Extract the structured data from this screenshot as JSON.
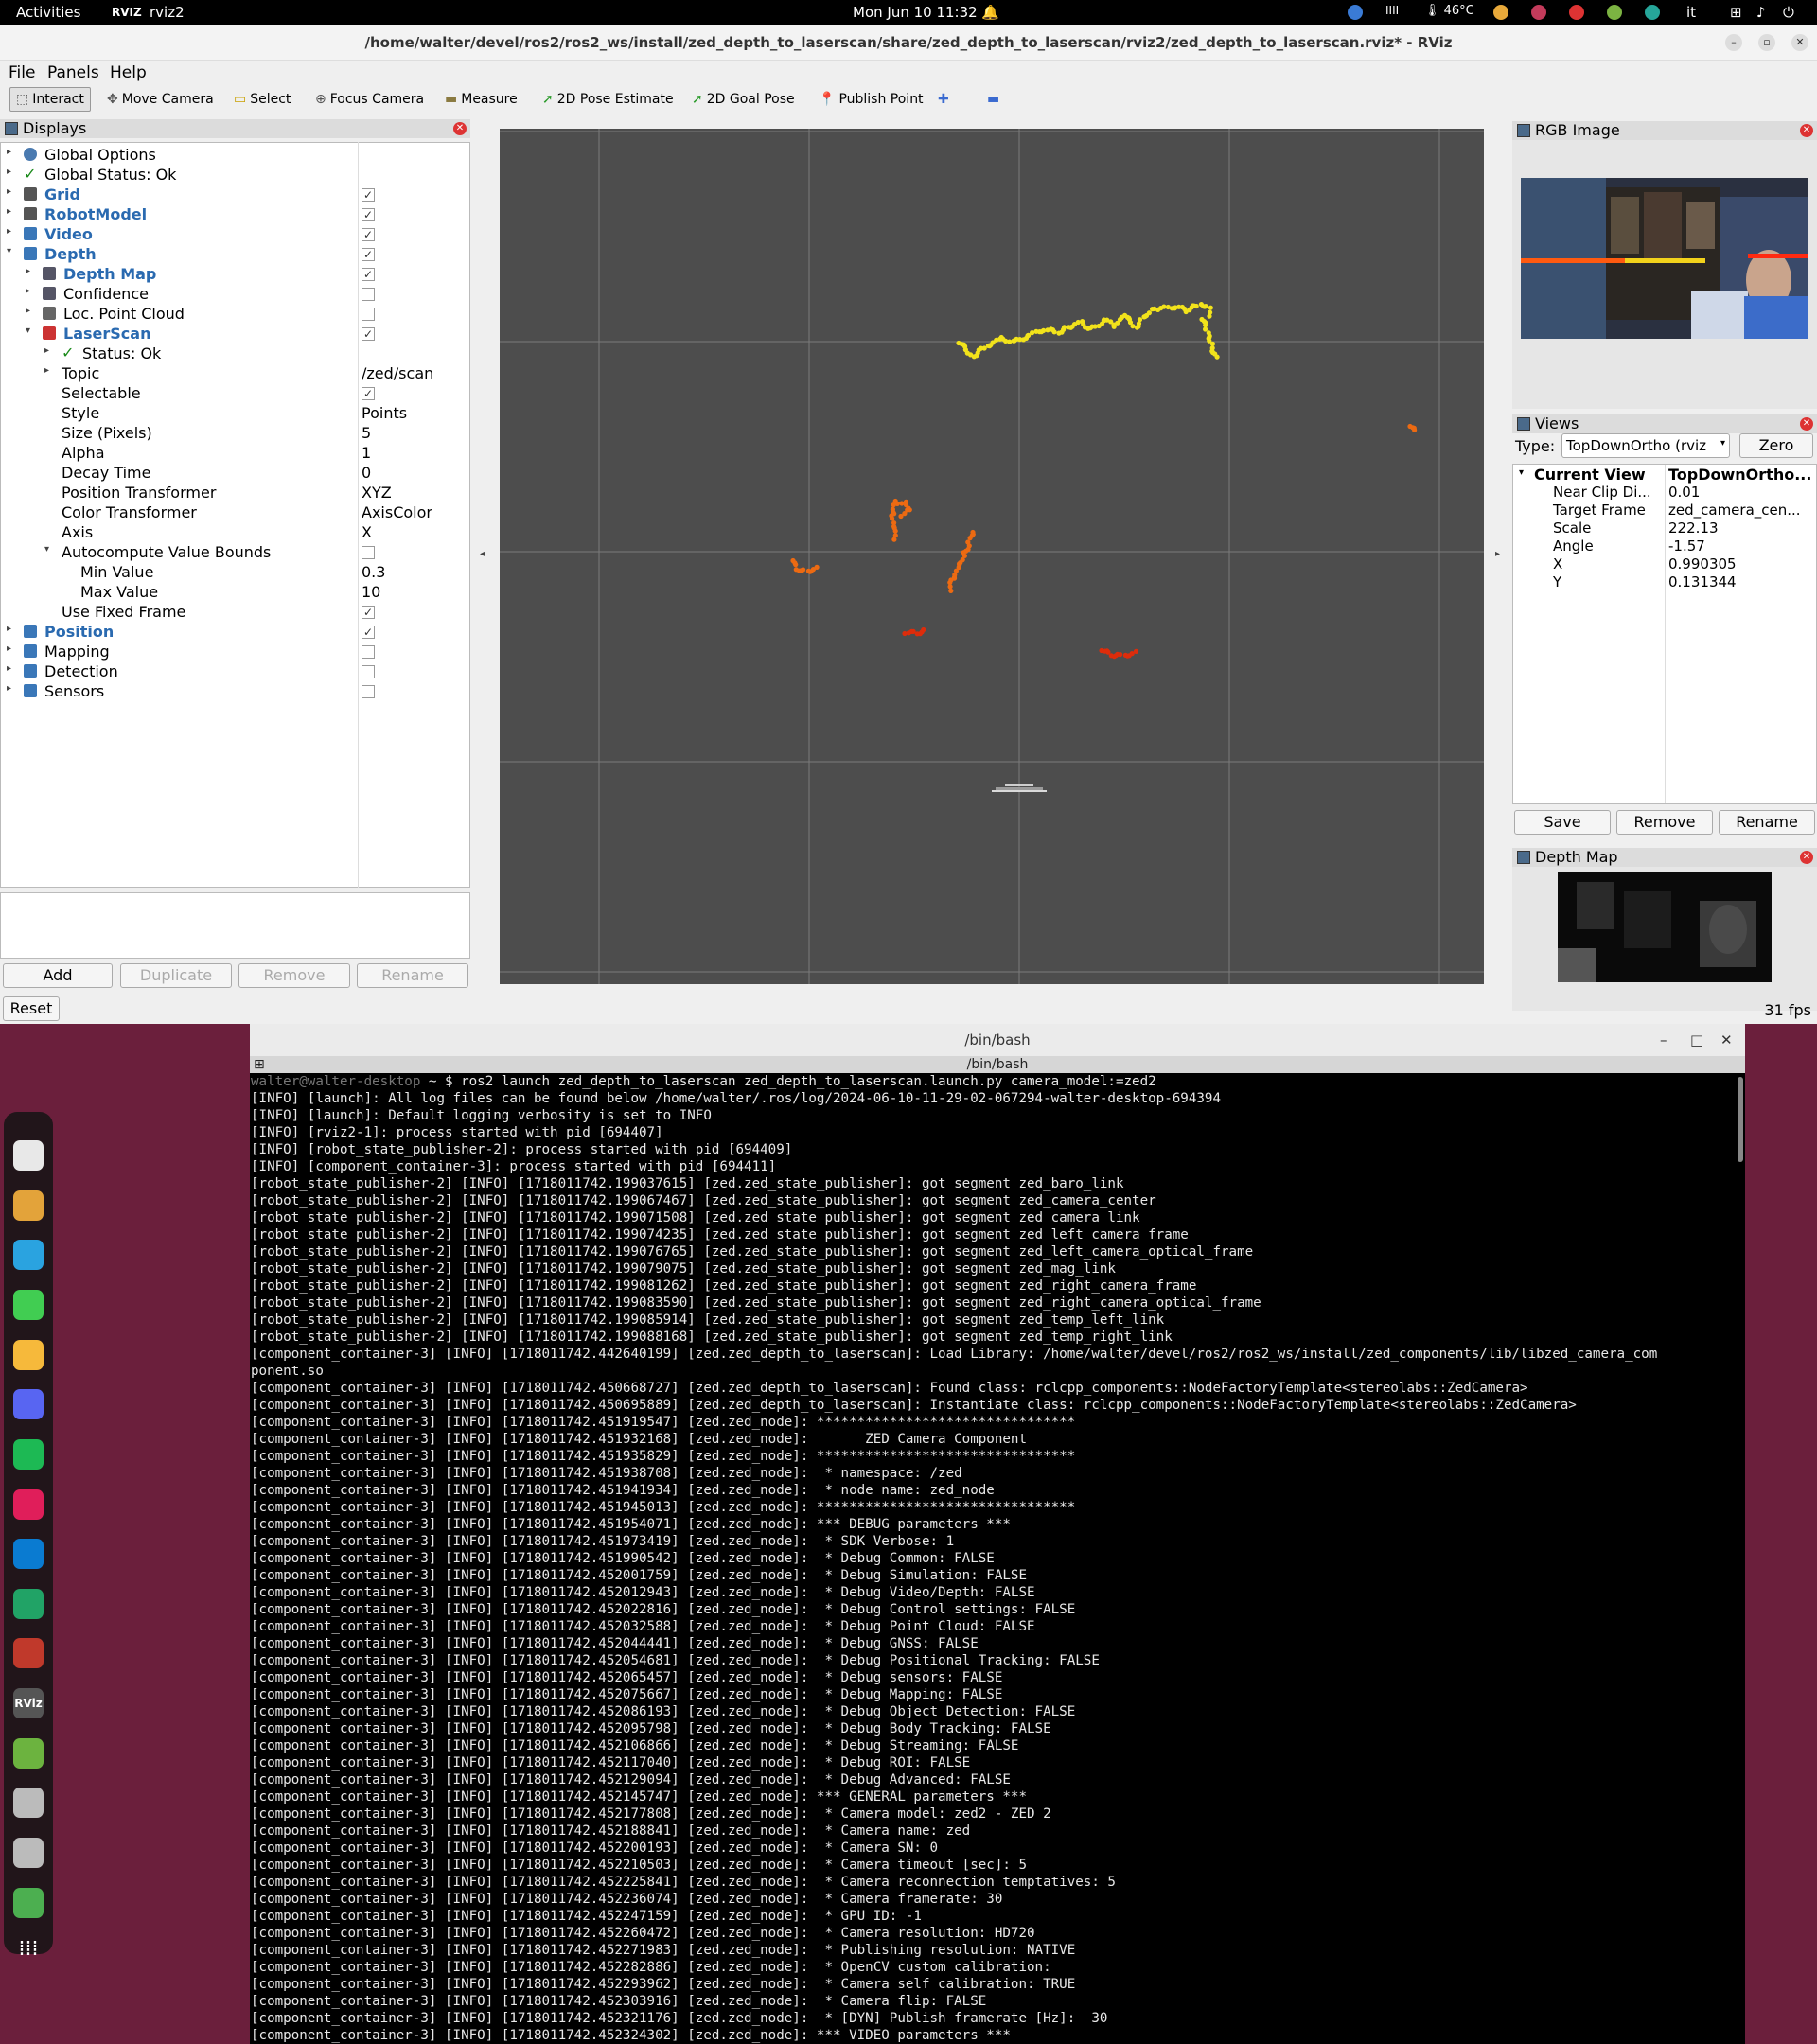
{
  "topbar": {
    "activities": "Activities",
    "app_name": "rviz2",
    "datetime": "Mon Jun 10  11:32",
    "temperature": "46°C",
    "lang": "it"
  },
  "rviz": {
    "window_title": "/home/walter/devel/ros2/ros2_ws/install/zed_depth_to_laserscan/share/zed_depth_to_laserscan/rviz2/zed_depth_to_laserscan.rviz* - RViz",
    "menu": [
      "File",
      "Panels",
      "Help"
    ],
    "tools": [
      "Interact",
      "Move Camera",
      "Select",
      "Focus Camera",
      "Measure",
      "2D Pose Estimate",
      "2D Goal Pose",
      "Publish Point"
    ],
    "displays_title": "Displays",
    "tree": [
      {
        "label": "Global Options",
        "depth": 0,
        "arrow": "▸",
        "icon": "gear-icon",
        "blue": false
      },
      {
        "label": "Global Status: Ok",
        "depth": 0,
        "arrow": "▸",
        "icon": "check-icon",
        "blue": false
      },
      {
        "label": "Grid",
        "depth": 0,
        "arrow": "▸",
        "icon": "grid-icon",
        "blue": true,
        "check": true
      },
      {
        "label": "RobotModel",
        "depth": 0,
        "arrow": "▸",
        "icon": "robot-icon",
        "blue": true,
        "check": true
      },
      {
        "label": "Video",
        "depth": 0,
        "arrow": "▸",
        "icon": "folder-icon",
        "blue": true,
        "check": true
      },
      {
        "label": "Depth",
        "depth": 0,
        "arrow": "▾",
        "icon": "folder-icon",
        "blue": true,
        "check": true
      },
      {
        "label": "Depth Map",
        "depth": 1,
        "arrow": "▸",
        "icon": "image-icon",
        "blue": true,
        "check": true
      },
      {
        "label": "Confidence",
        "depth": 1,
        "arrow": "▸",
        "icon": "image-icon",
        "blue": false,
        "check": false
      },
      {
        "label": "Loc. Point Cloud",
        "depth": 1,
        "arrow": "▸",
        "icon": "pointcloud-icon",
        "blue": false,
        "check": false
      },
      {
        "label": "LaserScan",
        "depth": 1,
        "arrow": "▾",
        "icon": "laserscan-icon",
        "blue": true,
        "check": true
      },
      {
        "label": "Status: Ok",
        "depth": 2,
        "arrow": "▸",
        "icon": "check-icon",
        "blue": false
      },
      {
        "label": "Topic",
        "depth": 2,
        "arrow": "▸",
        "value": "/zed/scan"
      },
      {
        "label": "Selectable",
        "depth": 2,
        "check": true
      },
      {
        "label": "Style",
        "depth": 2,
        "value": "Points"
      },
      {
        "label": "Size (Pixels)",
        "depth": 2,
        "value": "5"
      },
      {
        "label": "Alpha",
        "depth": 2,
        "value": "1"
      },
      {
        "label": "Decay Time",
        "depth": 2,
        "value": "0"
      },
      {
        "label": "Position Transformer",
        "depth": 2,
        "value": "XYZ"
      },
      {
        "label": "Color Transformer",
        "depth": 2,
        "value": "AxisColor"
      },
      {
        "label": "Axis",
        "depth": 2,
        "value": "X"
      },
      {
        "label": "Autocompute Value Bounds",
        "depth": 2,
        "arrow": "▾",
        "check": false
      },
      {
        "label": "Min Value",
        "depth": 3,
        "value": "0.3"
      },
      {
        "label": "Max Value",
        "depth": 3,
        "value": "10"
      },
      {
        "label": "Use Fixed Frame",
        "depth": 2,
        "check": true
      },
      {
        "label": "Position",
        "depth": 0,
        "arrow": "▸",
        "icon": "folder-icon",
        "blue": true,
        "check": true
      },
      {
        "label": "Mapping",
        "depth": 0,
        "arrow": "▸",
        "icon": "folder-icon",
        "blue": false,
        "check": false
      },
      {
        "label": "Detection",
        "depth": 0,
        "arrow": "▸",
        "icon": "folder-icon",
        "blue": false,
        "check": false
      },
      {
        "label": "Sensors",
        "depth": 0,
        "arrow": "▸",
        "icon": "folder-icon",
        "blue": false,
        "check": false
      }
    ],
    "buttons": {
      "add": "Add",
      "duplicate": "Duplicate",
      "remove": "Remove",
      "rename": "Rename",
      "reset": "Reset"
    },
    "fps": "31 fps",
    "rgb_title": "RGB Image",
    "views": {
      "title": "Views",
      "type_label": "Type:",
      "type_value": "TopDownOrtho (rviz",
      "zero": "Zero",
      "current_view": "Current View",
      "current_view_value": "TopDownOrtho...",
      "props": [
        [
          "Near Clip Di...",
          "0.01"
        ],
        [
          "Target Frame",
          "zed_camera_cen..."
        ],
        [
          "Scale",
          "222.13"
        ],
        [
          "Angle",
          "-1.57"
        ],
        [
          "X",
          "0.990305"
        ],
        [
          "Y",
          "0.131344"
        ]
      ],
      "save": "Save",
      "remove": "Remove",
      "rename": "Rename"
    },
    "depth_title": "Depth Map",
    "colors": {
      "yellow": "#f2e31b",
      "orange": "#ec6a12",
      "red": "#dd2c0b",
      "grid_bg": "#4d4d4d"
    }
  },
  "terminal": {
    "window_title": "/bin/bash",
    "tab_title": "/bin/bash",
    "prompt": "walter@walter-desktop",
    "command": " ~ $ ros2 launch zed_depth_to_laserscan zed_depth_to_laserscan.launch.py camera_model:=zed2",
    "lines": [
      "[INFO] [launch]: All log files can be found below /home/walter/.ros/log/2024-06-10-11-29-02-067294-walter-desktop-694394",
      "[INFO] [launch]: Default logging verbosity is set to INFO",
      "[INFO] [rviz2-1]: process started with pid [694407]",
      "[INFO] [robot_state_publisher-2]: process started with pid [694409]",
      "[INFO] [component_container-3]: process started with pid [694411]",
      "[robot_state_publisher-2] [INFO] [1718011742.199037615] [zed.zed_state_publisher]: got segment zed_baro_link",
      "[robot_state_publisher-2] [INFO] [1718011742.199067467] [zed.zed_state_publisher]: got segment zed_camera_center",
      "[robot_state_publisher-2] [INFO] [1718011742.199071508] [zed.zed_state_publisher]: got segment zed_camera_link",
      "[robot_state_publisher-2] [INFO] [1718011742.199074235] [zed.zed_state_publisher]: got segment zed_left_camera_frame",
      "[robot_state_publisher-2] [INFO] [1718011742.199076765] [zed.zed_state_publisher]: got segment zed_left_camera_optical_frame",
      "[robot_state_publisher-2] [INFO] [1718011742.199079075] [zed.zed_state_publisher]: got segment zed_mag_link",
      "[robot_state_publisher-2] [INFO] [1718011742.199081262] [zed.zed_state_publisher]: got segment zed_right_camera_frame",
      "[robot_state_publisher-2] [INFO] [1718011742.199083590] [zed.zed_state_publisher]: got segment zed_right_camera_optical_frame",
      "[robot_state_publisher-2] [INFO] [1718011742.199085914] [zed.zed_state_publisher]: got segment zed_temp_left_link",
      "[robot_state_publisher-2] [INFO] [1718011742.199088168] [zed.zed_state_publisher]: got segment zed_temp_right_link",
      "[component_container-3] [INFO] [1718011742.442640199] [zed.zed_depth_to_laserscan]: Load Library: /home/walter/devel/ros2/ros2_ws/install/zed_components/lib/libzed_camera_com",
      "ponent.so",
      "[component_container-3] [INFO] [1718011742.450668727] [zed.zed_depth_to_laserscan]: Found class: rclcpp_components::NodeFactoryTemplate<stereolabs::ZedCamera>",
      "[component_container-3] [INFO] [1718011742.450695889] [zed.zed_depth_to_laserscan]: Instantiate class: rclcpp_components::NodeFactoryTemplate<stereolabs::ZedCamera>",
      "[component_container-3] [INFO] [1718011742.451919547] [zed.zed_node]: ********************************",
      "[component_container-3] [INFO] [1718011742.451932168] [zed.zed_node]:       ZED Camera Component",
      "[component_container-3] [INFO] [1718011742.451935829] [zed.zed_node]: ********************************",
      "[component_container-3] [INFO] [1718011742.451938708] [zed.zed_node]:  * namespace: /zed",
      "[component_container-3] [INFO] [1718011742.451941934] [zed.zed_node]:  * node name: zed_node",
      "[component_container-3] [INFO] [1718011742.451945013] [zed.zed_node]: ********************************",
      "[component_container-3] [INFO] [1718011742.451954071] [zed.zed_node]: *** DEBUG parameters ***",
      "[component_container-3] [INFO] [1718011742.451973419] [zed.zed_node]:  * SDK Verbose: 1",
      "[component_container-3] [INFO] [1718011742.451990542] [zed.zed_node]:  * Debug Common: FALSE",
      "[component_container-3] [INFO] [1718011742.452001759] [zed.zed_node]:  * Debug Simulation: FALSE",
      "[component_container-3] [INFO] [1718011742.452012943] [zed.zed_node]:  * Debug Video/Depth: FALSE",
      "[component_container-3] [INFO] [1718011742.452022816] [zed.zed_node]:  * Debug Control settings: FALSE",
      "[component_container-3] [INFO] [1718011742.452032588] [zed.zed_node]:  * Debug Point Cloud: FALSE",
      "[component_container-3] [INFO] [1718011742.452044441] [zed.zed_node]:  * Debug GNSS: FALSE",
      "[component_container-3] [INFO] [1718011742.452054681] [zed.zed_node]:  * Debug Positional Tracking: FALSE",
      "[component_container-3] [INFO] [1718011742.452065457] [zed.zed_node]:  * Debug sensors: FALSE",
      "[component_container-3] [INFO] [1718011742.452075667] [zed.zed_node]:  * Debug Mapping: FALSE",
      "[component_container-3] [INFO] [1718011742.452086193] [zed.zed_node]:  * Debug Object Detection: FALSE",
      "[component_container-3] [INFO] [1718011742.452095798] [zed.zed_node]:  * Debug Body Tracking: FALSE",
      "[component_container-3] [INFO] [1718011742.452106866] [zed.zed_node]:  * Debug Streaming: FALSE",
      "[component_container-3] [INFO] [1718011742.452117040] [zed.zed_node]:  * Debug ROI: FALSE",
      "[component_container-3] [INFO] [1718011742.452129094] [zed.zed_node]:  * Debug Advanced: FALSE",
      "[component_container-3] [INFO] [1718011742.452145747] [zed.zed_node]: *** GENERAL parameters ***",
      "[component_container-3] [INFO] [1718011742.452177808] [zed.zed_node]:  * Camera model: zed2 - ZED 2",
      "[component_container-3] [INFO] [1718011742.452188841] [zed.zed_node]:  * Camera name: zed",
      "[component_container-3] [INFO] [1718011742.452200193] [zed.zed_node]:  * Camera SN: 0",
      "[component_container-3] [INFO] [1718011742.452210503] [zed.zed_node]:  * Camera timeout [sec]: 5",
      "[component_container-3] [INFO] [1718011742.452225841] [zed.zed_node]:  * Camera reconnection temptatives: 5",
      "[component_container-3] [INFO] [1718011742.452236074] [zed.zed_node]:  * Camera framerate: 30",
      "[component_container-3] [INFO] [1718011742.452247159] [zed.zed_node]:  * GPU ID: -1",
      "[component_container-3] [INFO] [1718011742.452260472] [zed.zed_node]:  * Camera resolution: HD720",
      "[component_container-3] [INFO] [1718011742.452271983] [zed.zed_node]:  * Publishing resolution: NATIVE",
      "[component_container-3] [INFO] [1718011742.452282886] [zed.zed_node]:  * OpenCV custom calibration:",
      "[component_container-3] [INFO] [1718011742.452293962] [zed.zed_node]:  * Camera self calibration: TRUE",
      "[component_container-3] [INFO] [1718011742.452303916] [zed.zed_node]:  * Camera flip: FALSE",
      "[component_container-3] [INFO] [1718011742.452321176] [zed.zed_node]:  * [DYN] Publish framerate [Hz]:  30",
      "[component_container-3] [INFO] [1718011742.452324302] [zed.zed_node]: *** VIDEO parameters ***"
    ]
  },
  "dock": {
    "icons": [
      "files-icon",
      "chrome-icon",
      "telegram-icon",
      "qtcreator-icon",
      "calculator-icon",
      "discord-icon",
      "spotify-icon",
      "slack-icon",
      "vscode-icon",
      "sheets-icon",
      "presentation-icon",
      "rviz-icon",
      "disk-green-icon",
      "ssd-icon",
      "ssd2-icon",
      "trash-icon",
      "apps-grid-icon"
    ]
  }
}
